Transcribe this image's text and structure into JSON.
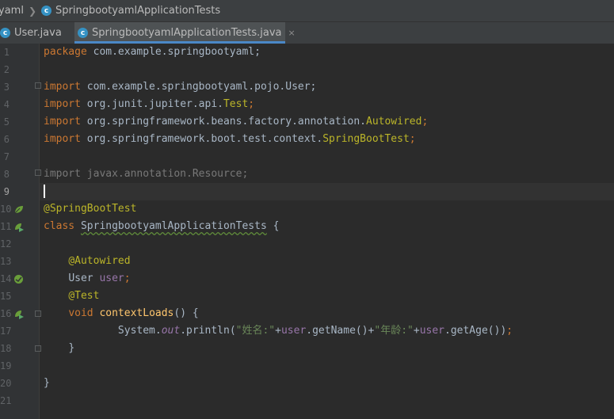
{
  "breadcrumb": {
    "first": "yaml",
    "second": "SpringbootyamlApplicationTests"
  },
  "tabs": [
    {
      "label": "User.java",
      "active": false
    },
    {
      "label": "SpringbootyamlApplicationTests.java",
      "active": true,
      "close": "×"
    }
  ],
  "editor": {
    "current_line": 9,
    "lines": [
      {
        "n": "1"
      },
      {
        "n": "2"
      },
      {
        "n": "3"
      },
      {
        "n": "4"
      },
      {
        "n": "5"
      },
      {
        "n": "6"
      },
      {
        "n": "7"
      },
      {
        "n": "8"
      },
      {
        "n": "9"
      },
      {
        "n": "10"
      },
      {
        "n": "11"
      },
      {
        "n": "12"
      },
      {
        "n": "13"
      },
      {
        "n": "14"
      },
      {
        "n": "15"
      },
      {
        "n": "16"
      },
      {
        "n": "17"
      },
      {
        "n": "18"
      },
      {
        "n": "19"
      },
      {
        "n": "20"
      },
      {
        "n": "21"
      }
    ],
    "code": {
      "l1": {
        "kw": "package",
        "rest": " com.example.springbootyaml;"
      },
      "l3": {
        "kw": "import",
        "rest": " com.example.springbootyaml.pojo.User;"
      },
      "l4": {
        "kw": "import",
        "rest": " org.junit.jupiter.api.",
        "ann": "Test",
        "end": ";"
      },
      "l5": {
        "kw": "import",
        "rest": " org.springframework.beans.factory.annotation.",
        "ann": "Autowired",
        "end": ";"
      },
      "l6": {
        "kw": "import",
        "rest": " org.springframework.boot.test.context.",
        "ann": "SpringBootTest",
        "end": ";"
      },
      "l8": {
        "text": "import javax.annotation.Resource;"
      },
      "l10": {
        "ann": "@SpringBootTest"
      },
      "l11": {
        "kw": "class",
        "name": "SpringbootyamlApplicationTests",
        "rest": " {"
      },
      "l13": {
        "ann": "@Autowired"
      },
      "l14": {
        "type": "User",
        "field": "user",
        "end": ";"
      },
      "l15": {
        "ann": "@Test"
      },
      "l16": {
        "kw": "void",
        "fn": "contextLoads",
        "rest": "() {"
      },
      "l17": {
        "p1": "System.",
        "out": "out",
        "p2": ".println(",
        "s1": "\"姓名:\"",
        "p3": "+",
        "f1": "user",
        "p4": ".getName()+",
        "s2": "\"年龄:\"",
        "p5": "+",
        "f2": "user",
        "p6": ".getAge())",
        "end": ";"
      },
      "l18": {
        "text": "}"
      },
      "l20": {
        "text": "}"
      }
    }
  },
  "colors": {
    "background": "#2b2b2b",
    "keyword": "#cc7832",
    "annotation": "#bbb529",
    "field": "#9876aa",
    "string": "#6a8759",
    "method": "#ffc66d",
    "accent": "#4a88c7"
  },
  "icons": [
    "class-icon",
    "spring-bean-icon",
    "run-test-icon",
    "fold-icon"
  ]
}
